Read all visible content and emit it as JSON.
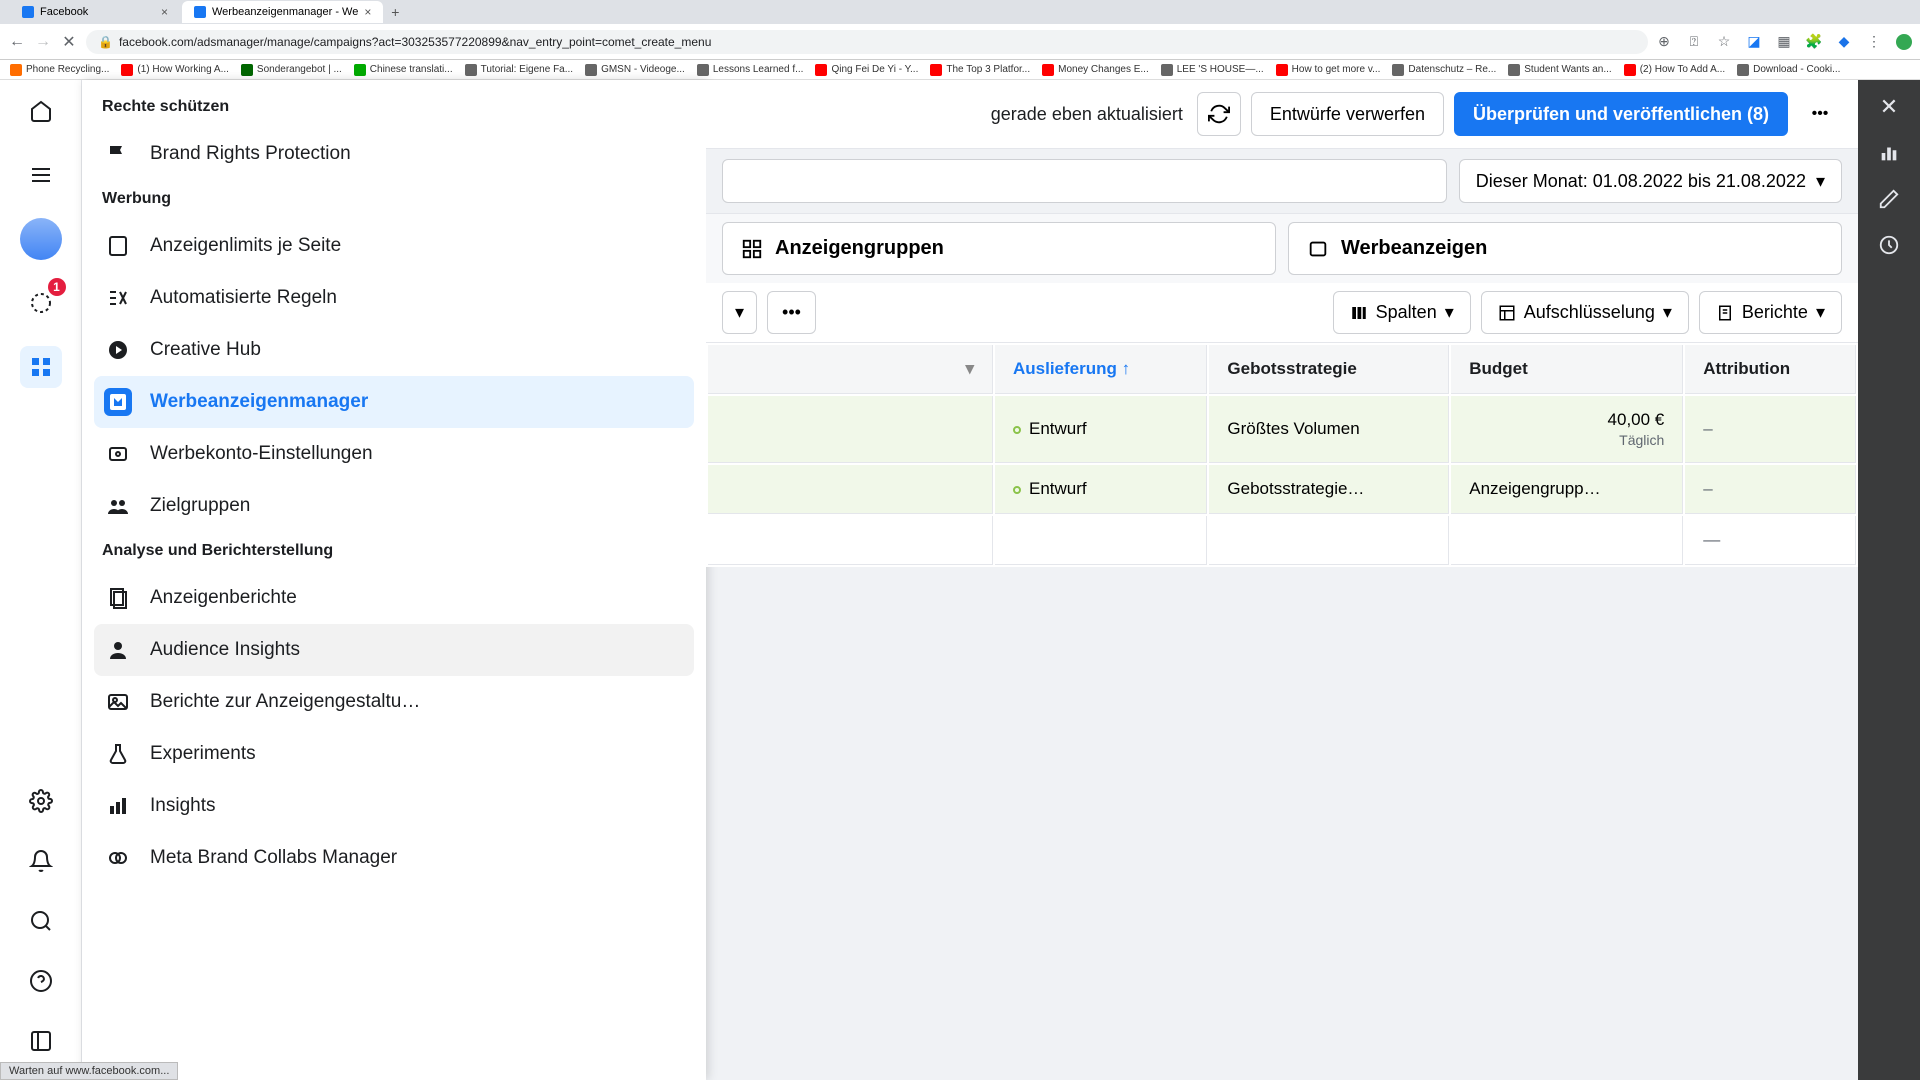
{
  "browser": {
    "tabs": [
      {
        "title": "Facebook",
        "active": false
      },
      {
        "title": "Werbeanzeigenmanager - We",
        "active": true
      }
    ],
    "url": "facebook.com/adsmanager/manage/campaigns?act=303253577220899&nav_entry_point=comet_create_menu",
    "bookmarks": [
      "Phone Recycling...",
      "(1) How Working A...",
      "Sonderangebot | ...",
      "Chinese translati...",
      "Tutorial: Eigene Fa...",
      "GMSN - Videoge...",
      "Lessons Learned f...",
      "Qing Fei De Yi - Y...",
      "The Top 3 Platfor...",
      "Money Changes E...",
      "LEE 'S HOUSE—...",
      "How to get more v...",
      "Datenschutz – Re...",
      "Student Wants an...",
      "(2) How To Add A...",
      "Download - Cooki..."
    ]
  },
  "leftRail": {
    "notification_count": "1"
  },
  "megaMenu": {
    "section1_title": "Rechte schützen",
    "section1_items": [
      {
        "label": "Brand Rights Protection",
        "icon": "flag"
      }
    ],
    "section2_title": "Werbung",
    "section2_items": [
      {
        "label": "Anzeigenlimits je Seite",
        "icon": "page"
      },
      {
        "label": "Automatisierte Regeln",
        "icon": "rules"
      },
      {
        "label": "Creative Hub",
        "icon": "creative"
      },
      {
        "label": "Werbeanzeigenmanager",
        "icon": "ads",
        "active": true
      },
      {
        "label": "Werbekonto-Einstellungen",
        "icon": "settings"
      },
      {
        "label": "Zielgruppen",
        "icon": "audience"
      }
    ],
    "section3_title": "Analyse und Berichterstellung",
    "section3_items": [
      {
        "label": "Anzeigenberichte",
        "icon": "reports"
      },
      {
        "label": "Audience Insights",
        "icon": "insights",
        "hovered": true
      },
      {
        "label": "Berichte zur Anzeigengestaltu…",
        "icon": "design"
      },
      {
        "label": "Experiments",
        "icon": "flask"
      },
      {
        "label": "Insights",
        "icon": "bars"
      },
      {
        "label": "Meta Brand Collabs Manager",
        "icon": "collab"
      }
    ]
  },
  "toolbar": {
    "updated_text": "gerade eben aktualisiert",
    "discard_label": "Entwürfe verwerfen",
    "publish_label": "Überprüfen und veröffentlichen (8)",
    "date_label": "Dieser Monat: 01.08.2022 bis 21.08.2022"
  },
  "levelTabs": {
    "adsets": "Anzeigengruppen",
    "ads": "Werbeanzeigen"
  },
  "tableToolbar": {
    "columns": "Spalten",
    "breakdown": "Aufschlüsselung",
    "reports": "Berichte"
  },
  "columns": {
    "delivery": "Auslieferung",
    "bid": "Gebotsstrategie",
    "budget": "Budget",
    "attribution": "Attribution"
  },
  "rows": [
    {
      "delivery": "Entwurf",
      "bid": "Größtes Volumen",
      "budget": "40,00 €",
      "budget_sub": "Täglich",
      "attribution": "–"
    },
    {
      "delivery": "Entwurf",
      "bid": "Gebotsstrategie…",
      "budget": "Anzeigengrupp…",
      "budget_sub": "",
      "attribution": "–"
    }
  ],
  "summary_attribution": "—",
  "statusBar": "Warten auf www.facebook.com..."
}
